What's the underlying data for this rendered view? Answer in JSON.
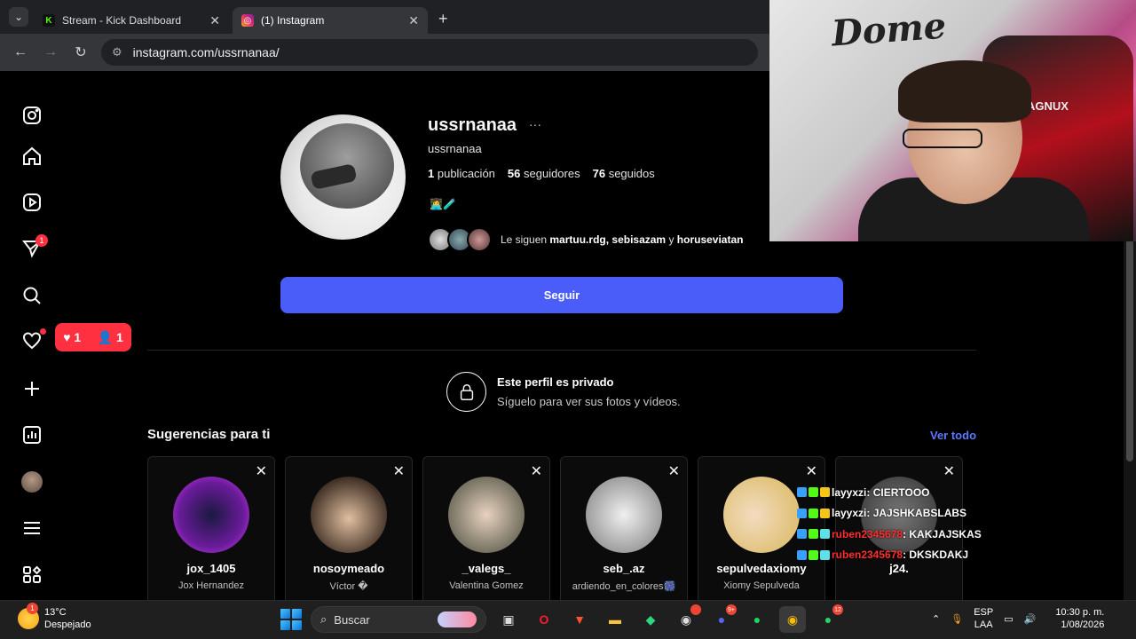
{
  "browser": {
    "tabs": [
      {
        "title": "Stream - Kick Dashboard",
        "favicon": "K",
        "color": "#53fc18"
      },
      {
        "title": "(1) Instagram",
        "favicon": "ig",
        "color": "#e1306c"
      }
    ],
    "new_tab": "+",
    "url": "instagram.com/ussrnanaa/"
  },
  "sidebar": {
    "messages_badge": "1",
    "notifications_popup": {
      "likes": "1",
      "follows": "1"
    }
  },
  "profile": {
    "username": "ussrnanaa",
    "more": "···",
    "handle": "ussrnanaa",
    "posts_count": "1",
    "posts_label": "publicación",
    "followers_count": "56",
    "followers_label": "seguidores",
    "following_count": "76",
    "following_label": "seguidos",
    "bio_emoji": "👩‍💻🧪",
    "followed_by_prefix": "Le siguen ",
    "followed_by_names": "martuu.rdg, sebisazam",
    "followed_by_and": " y ",
    "followed_by_last": "horuseviatan",
    "follow_button": "Seguir"
  },
  "private": {
    "title": "Este perfil es privado",
    "subtitle": "Síguelo para ver sus fotos y vídeos."
  },
  "suggestions": {
    "title": "Sugerencias para ti",
    "see_all": "Ver todo",
    "items": [
      {
        "username": "jox_1405",
        "full_name": "Jox Hernandez",
        "color": "#6a1b9a"
      },
      {
        "username": "nosoymeado",
        "full_name": "Víctor �",
        "color": "#c9a98c"
      },
      {
        "username": "_valegs_",
        "full_name": "Valentina Gomez",
        "color": "#8c7c6a"
      },
      {
        "username": "seb_.az",
        "full_name": "ardiendo_en_colores🎆",
        "color": "#9e9e9e"
      },
      {
        "username": "sepulvedaxiomy",
        "full_name": "Xiomy Sepulveda",
        "color": "#e0c27a"
      },
      {
        "username": "j24.",
        "full_name": "",
        "color": "#444444"
      }
    ]
  },
  "webcam": {
    "graffiti": "Dome",
    "chair_text": "AGNUX"
  },
  "chat": [
    {
      "user": "layyxzi",
      "message": ": CIERTOOO",
      "color": "#ffffff"
    },
    {
      "user": "layyxzi",
      "message": ": JAJSHKABSLABS",
      "color": "#ffffff"
    },
    {
      "user": "ruben2345678",
      "message": ": KAKJAJSKAS",
      "color": "#ff2d2d"
    },
    {
      "user": "ruben2345678",
      "message": ": DKSKDAKJ",
      "color": "#ff2d2d"
    }
  ],
  "taskbar": {
    "weather_badge": "1",
    "temperature": "13°C",
    "condition": "Despejado",
    "search_placeholder": "Buscar",
    "discord_badge": "9+",
    "whatsapp_badge": "12",
    "lang_top": "ESP",
    "lang_bottom": "LAA",
    "time": "10:30 p. m.",
    "date": "1/08/2026"
  }
}
